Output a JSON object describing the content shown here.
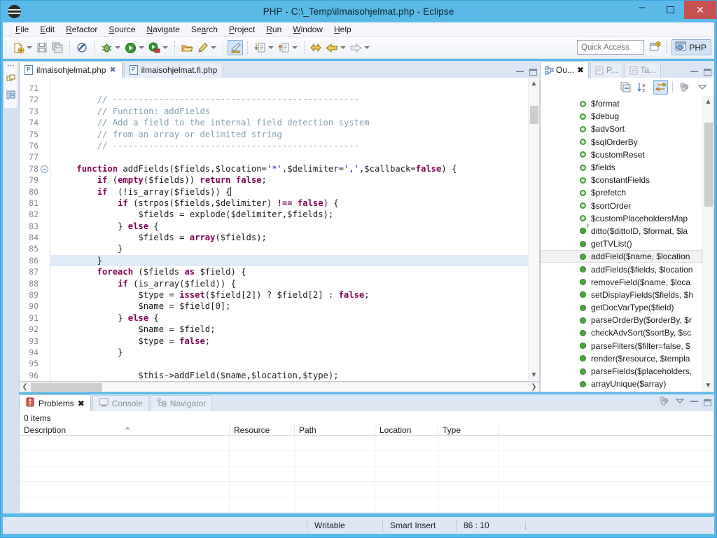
{
  "window": {
    "title": "PHP - C:\\_Temp\\ilmaisohjelmat.php - Eclipse",
    "minimize_label": "–",
    "maximize_label": "",
    "close_label": "✕",
    "accent_color": "#5ab9e8",
    "close_color": "#c75050"
  },
  "menubar": {
    "items": [
      {
        "pre": "",
        "u": "F",
        "post": "ile"
      },
      {
        "pre": "",
        "u": "E",
        "post": "dit"
      },
      {
        "pre": "",
        "u": "R",
        "post": "efactor"
      },
      {
        "pre": "",
        "u": "S",
        "post": "ource"
      },
      {
        "pre": "",
        "u": "N",
        "post": "avigate"
      },
      {
        "pre": "Se",
        "u": "a",
        "post": "rch"
      },
      {
        "pre": "",
        "u": "P",
        "post": "roject"
      },
      {
        "pre": "",
        "u": "R",
        "post": "un"
      },
      {
        "pre": "",
        "u": "W",
        "post": "indow"
      },
      {
        "pre": "",
        "u": "H",
        "post": "elp"
      }
    ]
  },
  "toolbar": {
    "quick_access_placeholder": "Quick Access",
    "perspective_label": "PHP",
    "buttons": [
      "new-file-button",
      "save-button",
      "save-all-button",
      "toggle-mark-occurrences-button",
      "debug-button",
      "run-button",
      "run-external-tools-button",
      "open-type-button",
      "edit-button",
      "highlight-button",
      "next-annotation-button",
      "previous-annotation-button",
      "back-button",
      "forward-button"
    ]
  },
  "fast_view_bar": {
    "icons": [
      "restore-perspective-icon",
      "php-explorer-icon"
    ]
  },
  "editor": {
    "tabs": [
      {
        "label": "ilmaisohjelmat.php",
        "active": true,
        "closable": true,
        "icon": "php-file-icon"
      },
      {
        "label": "ilmaisohjelmat.fi.php",
        "active": false,
        "closable": false,
        "icon": "php-file-icon"
      }
    ],
    "first_line": 71,
    "highlighted_line": 86,
    "folding_line": 78,
    "lines": [
      {
        "n": 71,
        "tokens": []
      },
      {
        "n": 72,
        "tokens": [
          {
            "t": "        ",
            "c": "v"
          },
          {
            "t": "// ------------------------------------------------",
            "c": "c"
          }
        ]
      },
      {
        "n": 73,
        "tokens": [
          {
            "t": "        ",
            "c": "v"
          },
          {
            "t": "// Function: addFields",
            "c": "c"
          }
        ]
      },
      {
        "n": 74,
        "tokens": [
          {
            "t": "        ",
            "c": "v"
          },
          {
            "t": "// Add a field to the internal field detection system",
            "c": "c"
          }
        ]
      },
      {
        "n": 75,
        "tokens": [
          {
            "t": "        ",
            "c": "v"
          },
          {
            "t": "// from an array or delimited string",
            "c": "c"
          }
        ]
      },
      {
        "n": 76,
        "tokens": [
          {
            "t": "        ",
            "c": "v"
          },
          {
            "t": "// ------------------------------------------------",
            "c": "c"
          }
        ]
      },
      {
        "n": 77,
        "tokens": []
      },
      {
        "n": 78,
        "tokens": [
          {
            "t": "    ",
            "c": "v"
          },
          {
            "t": "function",
            "c": "k"
          },
          {
            "t": " addFields($fields,$location=",
            "c": "v"
          },
          {
            "t": "'*'",
            "c": "s"
          },
          {
            "t": ",$delimiter=",
            "c": "v"
          },
          {
            "t": "','",
            "c": "s"
          },
          {
            "t": ",$callback=",
            "c": "v"
          },
          {
            "t": "false",
            "c": "k"
          },
          {
            "t": ") {",
            "c": "v"
          }
        ]
      },
      {
        "n": 79,
        "tokens": [
          {
            "t": "        ",
            "c": "v"
          },
          {
            "t": "if",
            "c": "k"
          },
          {
            "t": " (",
            "c": "v"
          },
          {
            "t": "empty",
            "c": "k"
          },
          {
            "t": "($fields)) ",
            "c": "v"
          },
          {
            "t": "return",
            "c": "k"
          },
          {
            "t": " ",
            "c": "v"
          },
          {
            "t": "false",
            "c": "k"
          },
          {
            "t": ";",
            "c": "v"
          }
        ]
      },
      {
        "n": 80,
        "tokens": [
          {
            "t": "        ",
            "c": "v"
          },
          {
            "t": "if",
            "c": "k"
          },
          {
            "t": "  (!is_array($fields)) {",
            "c": "v"
          }
        ]
      },
      {
        "n": 81,
        "tokens": [
          {
            "t": "            ",
            "c": "v"
          },
          {
            "t": "if",
            "c": "k"
          },
          {
            "t": " (strpos($fields,$delimiter) ",
            "c": "v"
          },
          {
            "t": "!==",
            "c": "k"
          },
          {
            "t": " ",
            "c": "v"
          },
          {
            "t": "false",
            "c": "k"
          },
          {
            "t": ") {",
            "c": "v"
          }
        ]
      },
      {
        "n": 82,
        "tokens": [
          {
            "t": "                $fields = explode($delimiter,$fields);",
            "c": "v"
          }
        ]
      },
      {
        "n": 83,
        "tokens": [
          {
            "t": "            } ",
            "c": "v"
          },
          {
            "t": "else",
            "c": "k"
          },
          {
            "t": " {",
            "c": "v"
          }
        ]
      },
      {
        "n": 84,
        "tokens": [
          {
            "t": "                $fields = ",
            "c": "v"
          },
          {
            "t": "array",
            "c": "k"
          },
          {
            "t": "($fields);",
            "c": "v"
          }
        ]
      },
      {
        "n": 85,
        "tokens": [
          {
            "t": "            }",
            "c": "v"
          }
        ]
      },
      {
        "n": 86,
        "tokens": [
          {
            "t": "        }",
            "c": "v"
          }
        ]
      },
      {
        "n": 87,
        "tokens": [
          {
            "t": "        ",
            "c": "v"
          },
          {
            "t": "foreach",
            "c": "k"
          },
          {
            "t": " ($fields ",
            "c": "v"
          },
          {
            "t": "as",
            "c": "k"
          },
          {
            "t": " $field) {",
            "c": "v"
          }
        ]
      },
      {
        "n": 88,
        "tokens": [
          {
            "t": "            ",
            "c": "v"
          },
          {
            "t": "if",
            "c": "k"
          },
          {
            "t": " (is_array($field)) {",
            "c": "v"
          }
        ]
      },
      {
        "n": 89,
        "tokens": [
          {
            "t": "                $type = ",
            "c": "v"
          },
          {
            "t": "isset",
            "c": "k"
          },
          {
            "t": "($field[2]) ? $field[2] : ",
            "c": "v"
          },
          {
            "t": "false",
            "c": "k"
          },
          {
            "t": ";",
            "c": "v"
          }
        ]
      },
      {
        "n": 90,
        "tokens": [
          {
            "t": "                $name = $field[0];",
            "c": "v"
          }
        ]
      },
      {
        "n": 91,
        "tokens": [
          {
            "t": "            } ",
            "c": "v"
          },
          {
            "t": "else",
            "c": "k"
          },
          {
            "t": " {",
            "c": "v"
          }
        ]
      },
      {
        "n": 92,
        "tokens": [
          {
            "t": "                $name = $field;",
            "c": "v"
          }
        ]
      },
      {
        "n": 93,
        "tokens": [
          {
            "t": "                $type = ",
            "c": "v"
          },
          {
            "t": "false",
            "c": "k"
          },
          {
            "t": ";",
            "c": "v"
          }
        ]
      },
      {
        "n": 94,
        "tokens": [
          {
            "t": "            }",
            "c": "v"
          }
        ]
      },
      {
        "n": 95,
        "tokens": []
      },
      {
        "n": 96,
        "tokens": [
          {
            "t": "                $this->addField($name,$location,$type);",
            "c": "v"
          }
        ]
      }
    ]
  },
  "outline": {
    "tabs": [
      {
        "label": "Ou...",
        "active": true,
        "closable": true,
        "icon": "outline-icon"
      },
      {
        "label": "P...",
        "active": false,
        "closable": false,
        "icon": "properties-icon"
      },
      {
        "label": "Ta...",
        "active": false,
        "closable": false,
        "icon": "tasks-icon"
      }
    ],
    "toolbar_buttons": [
      "collapse-all-icon",
      "sort-alphabetically-icon",
      "hide-fields-icon",
      "view-menu-icon"
    ],
    "selected_item": "addField($name, $location",
    "items": [
      {
        "label": "$format",
        "kind": "field"
      },
      {
        "label": "$debug",
        "kind": "field"
      },
      {
        "label": "$advSort",
        "kind": "field"
      },
      {
        "label": "$sqlOrderBy",
        "kind": "field"
      },
      {
        "label": "$customReset",
        "kind": "field"
      },
      {
        "label": "$fields",
        "kind": "field"
      },
      {
        "label": "$constantFields",
        "kind": "field"
      },
      {
        "label": "$prefetch",
        "kind": "field"
      },
      {
        "label": "$sortOrder",
        "kind": "field"
      },
      {
        "label": "$customPlaceholdersMap",
        "kind": "field"
      },
      {
        "label": "ditto($dittoID, $format, $la",
        "kind": "constructor"
      },
      {
        "label": "getTVList()",
        "kind": "method"
      },
      {
        "label": "addField($name, $location",
        "kind": "method"
      },
      {
        "label": "addFields($fields, $location",
        "kind": "method"
      },
      {
        "label": "removeField($name, $loca",
        "kind": "method"
      },
      {
        "label": "setDisplayFields($fields, $h",
        "kind": "method"
      },
      {
        "label": "getDocVarType($field)",
        "kind": "method"
      },
      {
        "label": "parseOrderBy($orderBy, $r",
        "kind": "method"
      },
      {
        "label": "checkAdvSort($sortBy, $sc",
        "kind": "method"
      },
      {
        "label": "parseFilters($filter=false, $",
        "kind": "method"
      },
      {
        "label": "render($resource, $templa",
        "kind": "method"
      },
      {
        "label": "parseFields($placeholders,",
        "kind": "method"
      },
      {
        "label": "arrayUnique($array)",
        "kind": "method"
      }
    ]
  },
  "problems": {
    "tabs": [
      {
        "label": "Problems",
        "active": true,
        "closable": true,
        "icon": "problems-icon"
      },
      {
        "label": "Console",
        "active": false,
        "closable": false,
        "icon": "console-icon"
      },
      {
        "label": "Navigator",
        "active": false,
        "closable": false,
        "icon": "navigator-icon"
      }
    ],
    "items_count": "0 items",
    "columns": [
      "Description",
      "Resource",
      "Path",
      "Location",
      "Type"
    ],
    "rows": []
  },
  "statusbar": {
    "writable": "Writable",
    "insert_mode": "Smart Insert",
    "cursor_position": "86 : 10"
  }
}
